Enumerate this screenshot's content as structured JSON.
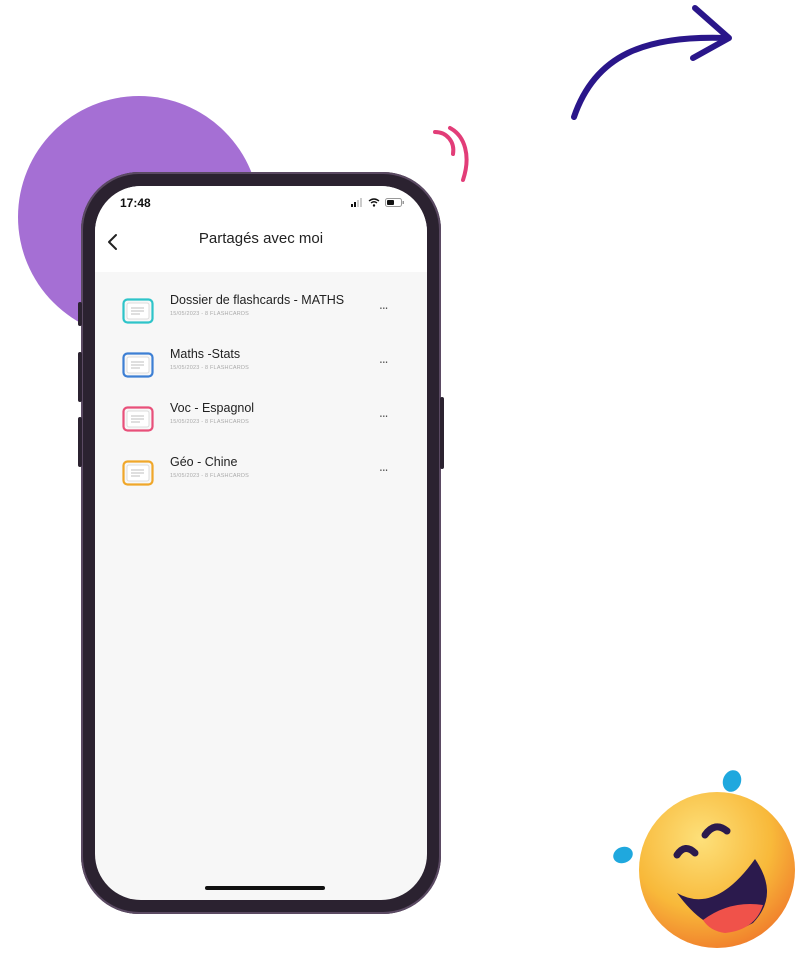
{
  "status_bar": {
    "time": "17:48"
  },
  "header": {
    "title": "Partagés avec moi",
    "back_icon": "chevron-left-icon"
  },
  "folders": [
    {
      "title": "Dossier de flashcards - MATHS",
      "meta": "15/05/2023 - 8 FLASHCARDS",
      "color": "#2ec4c9",
      "icon": "flashcard-folder-icon",
      "menu": "..."
    },
    {
      "title": "Maths -Stats",
      "meta": "15/05/2023 - 8 FLASHCARDS",
      "color": "#3d7fd4",
      "icon": "flashcard-folder-icon",
      "menu": "..."
    },
    {
      "title": "Voc - Espagnol",
      "meta": "15/05/2023 - 8 FLASHCARDS",
      "color": "#e8507a",
      "icon": "flashcard-folder-icon",
      "menu": "..."
    },
    {
      "title": "Géo - Chine",
      "meta": "15/05/2023 - 8 FLASHCARDS",
      "color": "#f0a72a",
      "icon": "flashcard-folder-icon",
      "menu": "..."
    }
  ],
  "colors": {
    "blob": "#a56fd4",
    "arrow": "#2a168a",
    "squiggle": "#e23d78",
    "emoji_face": "#f8b93a",
    "emoji_drops": "#1fa8de"
  }
}
